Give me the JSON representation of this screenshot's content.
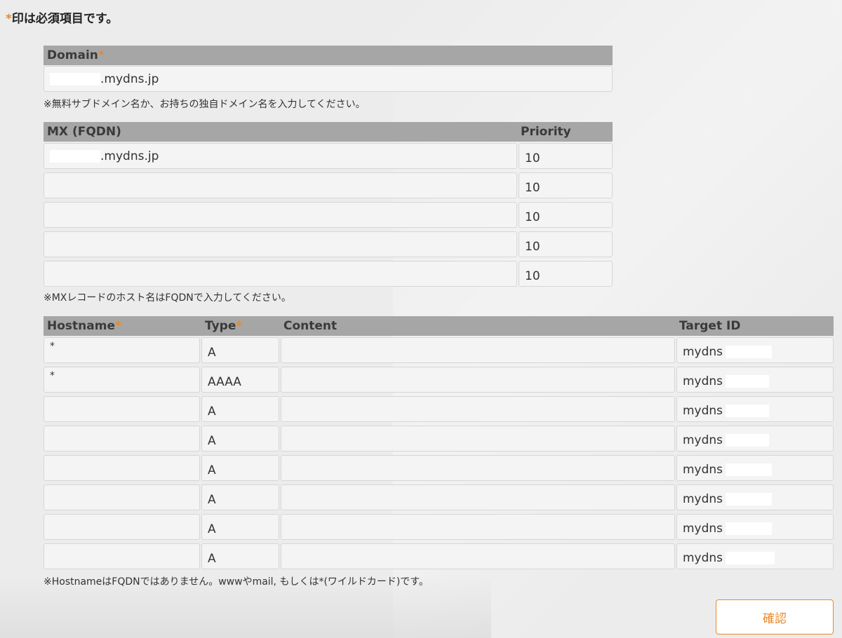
{
  "required_note": {
    "asterisk": "*",
    "text": "印は必須項目です。"
  },
  "domain": {
    "label": "Domain",
    "asterisk": "*",
    "value_suffix": ".mydns.jp",
    "hint": "※無料サブドメイン名か、お持ちの独自ドメイン名を入力してください。"
  },
  "mx": {
    "label_fqdn": "MX (FQDN)",
    "label_priority": "Priority",
    "rows": [
      {
        "fqdn": ".mydns.jp",
        "priority": "10"
      },
      {
        "fqdn": "",
        "priority": "10"
      },
      {
        "fqdn": "",
        "priority": "10"
      },
      {
        "fqdn": "",
        "priority": "10"
      },
      {
        "fqdn": "",
        "priority": "10"
      }
    ],
    "hint": "※MXレコードのホスト名はFQDNで入力してください。"
  },
  "records": {
    "headers": {
      "hostname": "Hostname",
      "type": "Type",
      "content": "Content",
      "target": "Target ID"
    },
    "asterisk": "*",
    "rows": [
      {
        "hostname": "*",
        "type": "A",
        "content": "",
        "target": "mydns"
      },
      {
        "hostname": "*",
        "type": "AAAA",
        "content": "",
        "target": "mydns"
      },
      {
        "hostname": "",
        "type": "A",
        "content": "",
        "target": "mydns"
      },
      {
        "hostname": "",
        "type": "A",
        "content": "",
        "target": "mydns"
      },
      {
        "hostname": "",
        "type": "A",
        "content": "",
        "target": "mydns"
      },
      {
        "hostname": "",
        "type": "A",
        "content": "",
        "target": "mydns"
      },
      {
        "hostname": "",
        "type": "A",
        "content": "",
        "target": "mydns"
      },
      {
        "hostname": "",
        "type": "A",
        "content": "",
        "target": "mydns"
      }
    ],
    "hint": "※HostnameはFQDNではありません。wwwやmail, もしくは*(ワイルドカード)です。"
  },
  "confirm_button": "確認"
}
